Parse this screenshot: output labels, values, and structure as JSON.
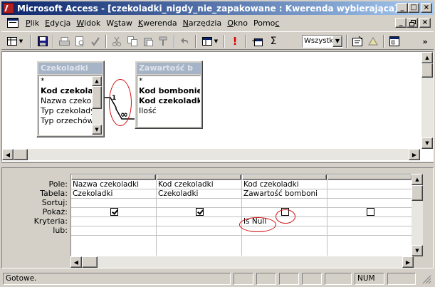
{
  "window": {
    "title": "Microsoft Access - [czekoladki_nigdy_nie_zapakowane : Kwerenda wybierająca]",
    "minimize": "_",
    "maximize": "□",
    "close": "×"
  },
  "menu": {
    "items": [
      "Plik",
      "Edycja",
      "Widok",
      "Wstaw",
      "Kwerenda",
      "Narzędzia",
      "Okno",
      "Pomoc"
    ],
    "accel": [
      "P",
      "E",
      "W",
      "s",
      "K",
      "N",
      "O",
      "c"
    ]
  },
  "toolbar": {
    "top_values_combo": "Wszystk",
    "sigma": "Σ",
    "run": "!",
    "overflow": "»"
  },
  "tables": [
    {
      "name": "Czekoladki",
      "fields": [
        {
          "label": "*",
          "bold": false
        },
        {
          "label": "Kod czekoladk",
          "bold": true
        },
        {
          "label": "Nazwa czekola",
          "bold": false
        },
        {
          "label": "Typ czekolady",
          "bold": false
        },
        {
          "label": "Typ orzechów",
          "bold": false
        }
      ]
    },
    {
      "name": "Zawartość b",
      "fields": [
        {
          "label": "*",
          "bold": false
        },
        {
          "label": "Kod bombonierki",
          "bold": true
        },
        {
          "label": "Kod czekoladki",
          "bold": true
        },
        {
          "label": "Ilość",
          "bold": false
        }
      ]
    }
  ],
  "join": {
    "one_side": "1",
    "many_side": "∞"
  },
  "grid": {
    "row_labels": [
      "Pole:",
      "Tabela:",
      "Sortuj:",
      "Pokaż:",
      "Kryteria:",
      "lub:"
    ],
    "columns": [
      {
        "field": "Nazwa czekoladki",
        "table": "Czekoladki",
        "sort": "",
        "show": true,
        "criteria": "",
        "or": ""
      },
      {
        "field": "Kod czekoladki",
        "table": "Czekoladki",
        "sort": "",
        "show": true,
        "criteria": "",
        "or": ""
      },
      {
        "field": "Kod czekoladki",
        "table": "Zawartość bomboni",
        "sort": "",
        "show": false,
        "criteria": "Is Null",
        "or": ""
      },
      {
        "field": "",
        "table": "",
        "sort": "",
        "show": false,
        "criteria": "",
        "or": ""
      }
    ]
  },
  "status": {
    "text": "Gotowe.",
    "num": "NUM"
  },
  "annotation_color": "#d01010"
}
